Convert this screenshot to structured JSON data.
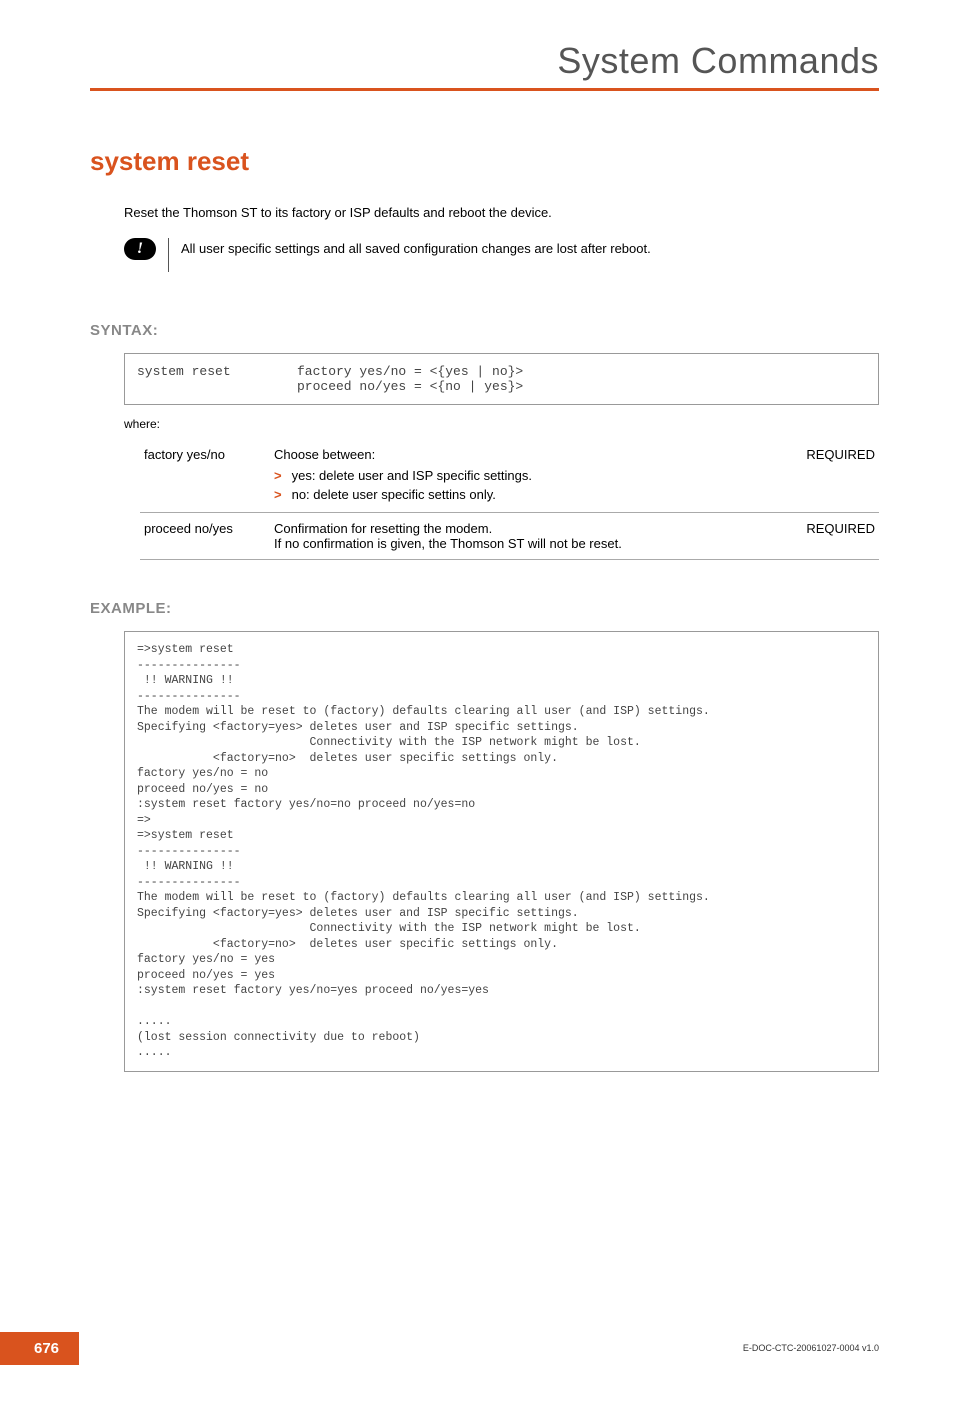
{
  "header": {
    "title": "System Commands"
  },
  "command": {
    "title": "system reset",
    "intro": "Reset the Thomson ST to its factory or ISP defaults and reboot the device.",
    "callout": "All user specific settings and all saved configuration changes are lost after reboot."
  },
  "syntax": {
    "heading": "SYNTAX:",
    "cmd": "system reset",
    "args": "factory yes/no = <{yes | no}>\nproceed no/yes = <{no | yes}>",
    "where": "where:"
  },
  "params": [
    {
      "name": "factory yes/no",
      "desc_intro": "Choose between:",
      "bullets": [
        "yes: delete user and ISP specific settings.",
        "no: delete user specific settins only."
      ],
      "req": "REQUIRED"
    },
    {
      "name": "proceed no/yes",
      "desc_lines": [
        "Confirmation for resetting the modem.",
        "If no confirmation is given, the Thomson ST will not be reset."
      ],
      "req": "REQUIRED"
    }
  ],
  "example": {
    "heading": "EXAMPLE:",
    "text": "=>system reset\n---------------\n !! WARNING !!\n---------------\nThe modem will be reset to (factory) defaults clearing all user (and ISP) settings.\nSpecifying <factory=yes> deletes user and ISP specific settings.\n                         Connectivity with the ISP network might be lost.\n           <factory=no>  deletes user specific settings only.\nfactory yes/no = no\nproceed no/yes = no\n:system reset factory yes/no=no proceed no/yes=no\n=>\n=>system reset\n---------------\n !! WARNING !!\n---------------\nThe modem will be reset to (factory) defaults clearing all user (and ISP) settings.\nSpecifying <factory=yes> deletes user and ISP specific settings.\n                         Connectivity with the ISP network might be lost.\n           <factory=no>  deletes user specific settings only.\nfactory yes/no = yes\nproceed no/yes = yes\n:system reset factory yes/no=yes proceed no/yes=yes\n\n.....\n(lost session connectivity due to reboot)\n....."
  },
  "footer": {
    "page": "676",
    "docid": "E-DOC-CTC-20061027-0004 v1.0"
  }
}
